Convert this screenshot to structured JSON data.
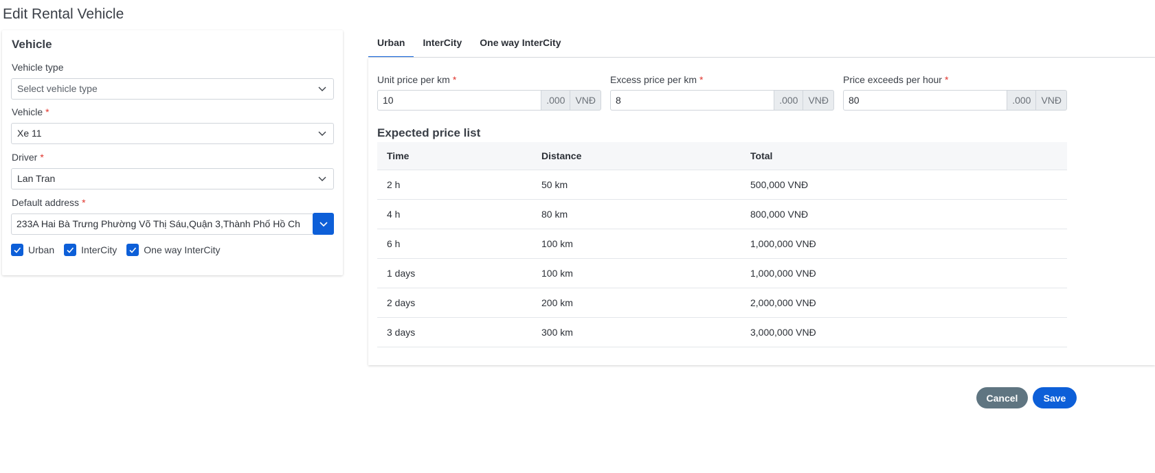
{
  "page": {
    "title": "Edit Rental Vehicle"
  },
  "vehicle_card": {
    "title": "Vehicle",
    "vehicle_type": {
      "label": "Vehicle type",
      "placeholder": "Select vehicle type"
    },
    "vehicle": {
      "label": "Vehicle",
      "required": "*",
      "value": "Xe 11"
    },
    "driver": {
      "label": "Driver",
      "required": "*",
      "value": "Lan Tran"
    },
    "default_address": {
      "label": "Default address",
      "required": "*",
      "value": "233A Hai Bà Trưng Phường Võ Thị Sáu,Quận 3,Thành Phố Hồ Ch"
    },
    "checkboxes": [
      {
        "label": "Urban",
        "checked": true
      },
      {
        "label": "InterCity",
        "checked": true
      },
      {
        "label": "One way InterCity",
        "checked": true
      }
    ]
  },
  "tabs": [
    {
      "label": "Urban",
      "active": true
    },
    {
      "label": "InterCity",
      "active": false
    },
    {
      "label": "One way InterCity",
      "active": false
    }
  ],
  "pricing": {
    "unit_price": {
      "label": "Unit price per km",
      "required": "*",
      "value": "10",
      "suffix": ".000",
      "currency": "VNĐ"
    },
    "excess_price": {
      "label": "Excess price per km",
      "required": "*",
      "value": "8",
      "suffix": ".000",
      "currency": "VNĐ"
    },
    "hour_price": {
      "label": "Price exceeds per hour",
      "required": "*",
      "value": "80",
      "suffix": ".000",
      "currency": "VNĐ"
    }
  },
  "price_list": {
    "title": "Expected price list",
    "columns": [
      "Time",
      "Distance",
      "Total"
    ],
    "rows": [
      [
        "2 h",
        "50 km",
        "500,000 VNĐ"
      ],
      [
        "4 h",
        "80 km",
        "800,000 VNĐ"
      ],
      [
        "6 h",
        "100 km",
        "1,000,000 VNĐ"
      ],
      [
        "1 days",
        "100 km",
        "1,000,000 VNĐ"
      ],
      [
        "2 days",
        "200 km",
        "2,000,000 VNĐ"
      ],
      [
        "3 days",
        "300 km",
        "3,000,000 VNĐ"
      ]
    ]
  },
  "actions": {
    "cancel_label": "Cancel",
    "save_label": "Save"
  },
  "colors": {
    "primary": "#0d5fd8",
    "cancel": "#5f7581",
    "required": "#e0342c"
  }
}
